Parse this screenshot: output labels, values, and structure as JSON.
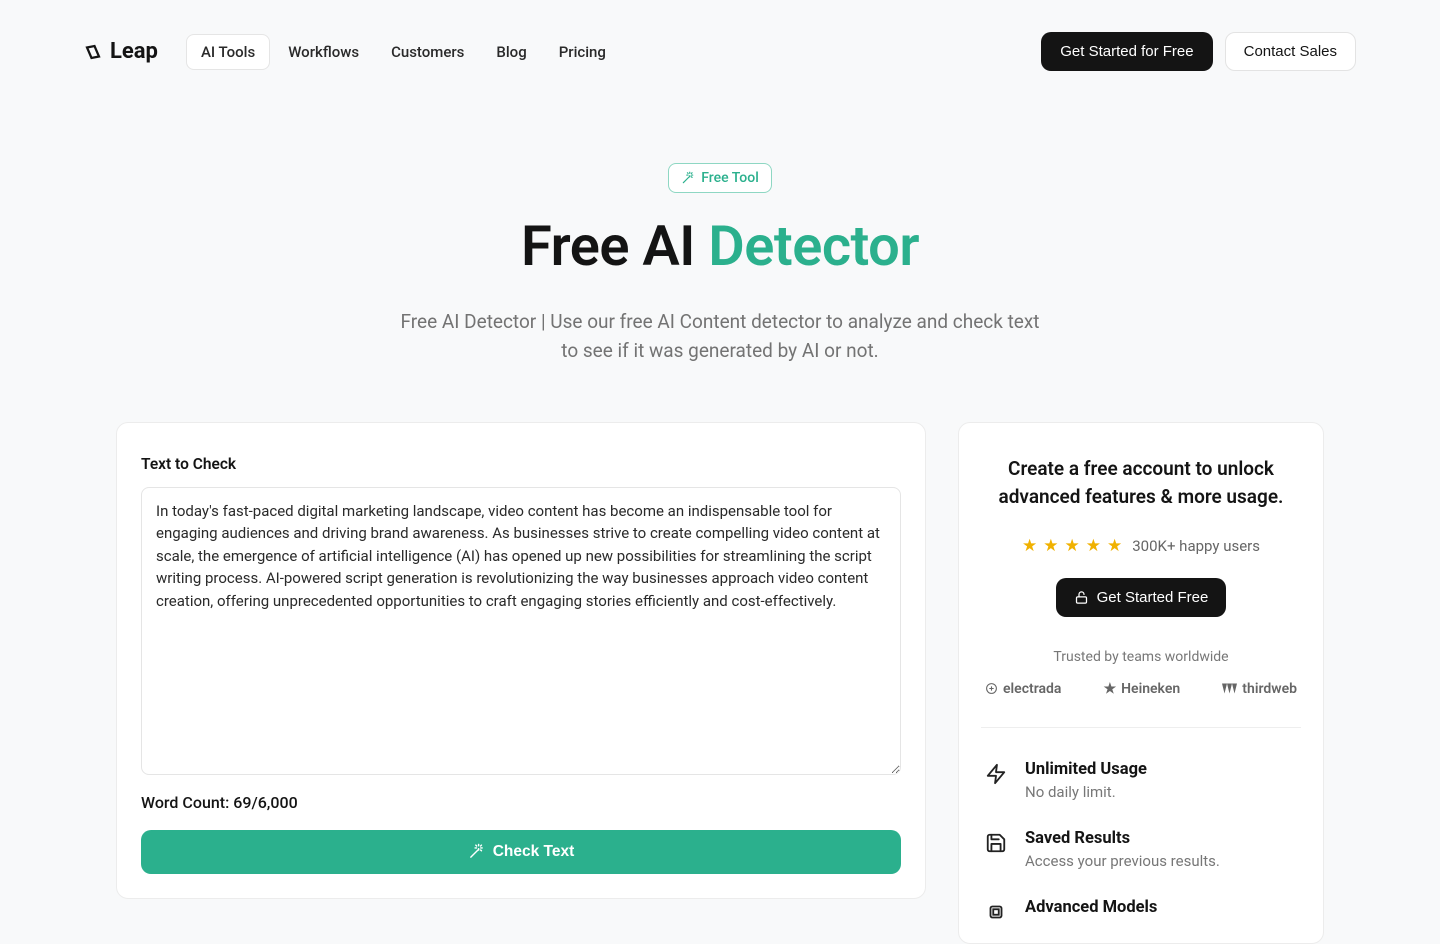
{
  "brand": "Leap",
  "nav": {
    "items": [
      "AI Tools",
      "Workflows",
      "Customers",
      "Blog",
      "Pricing"
    ],
    "active_index": 0
  },
  "header_buttons": {
    "primary": "Get Started for Free",
    "secondary": "Contact Sales"
  },
  "hero": {
    "badge": "Free Tool",
    "title_a": "Free AI ",
    "title_accent": "Detector",
    "subtitle": "Free AI Detector | Use our free AI Content detector to analyze and check text to see if it was generated by AI or not."
  },
  "main": {
    "label": "Text to Check",
    "text": "In today's fast-paced digital marketing landscape, video content has become an indispensable tool for engaging audiences and driving brand awareness. As businesses strive to create compelling video content at scale, the emergence of artificial intelligence (AI) has opened up new possibilities for streamlining the script writing process. AI-powered script generation is revolutionizing the way businesses approach video content creation, offering unprecedented opportunities to craft engaging stories efficiently and cost-effectively.",
    "word_count_label": "Word Count: 69/6,000",
    "check_button": "Check Text"
  },
  "side": {
    "title": "Create a free account to unlock advanced features & more usage.",
    "users": "300K+ happy users",
    "cta": "Get Started Free",
    "trusted": "Trusted by teams worldwide",
    "brands": [
      "electrada",
      "Heineken",
      "thirdweb"
    ],
    "features": [
      {
        "title": "Unlimited Usage",
        "desc": "No daily limit."
      },
      {
        "title": "Saved Results",
        "desc": "Access your previous results."
      },
      {
        "title": "Advanced Models",
        "desc": ""
      }
    ]
  }
}
